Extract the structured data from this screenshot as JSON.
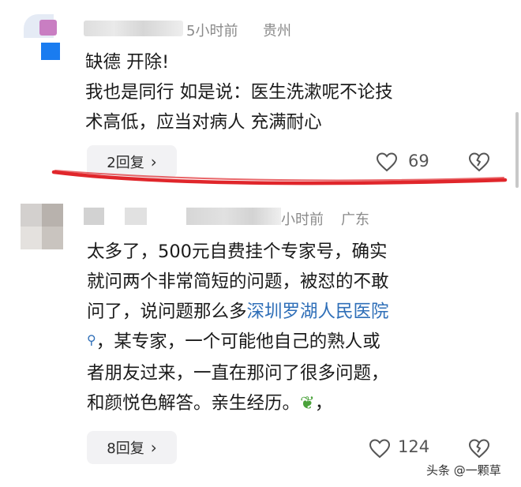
{
  "comments": [
    {
      "time": "5小时前",
      "location": "贵州",
      "lines": [
        "缺德 开除!",
        "我也是同行 如是说：医生洗漱呢不论技",
        "术高低，应当对病人 充满耐心"
      ],
      "reply_label": "2回复",
      "likes": "69"
    },
    {
      "time": "小时前",
      "location": "广东",
      "lines": [
        "太多了，500元自费挂个专家号，确实",
        "就问两个非常简短的问题，被怼的不敢",
        "问了，说问题那么多"
      ],
      "link_text": "深圳罗湖人民医院",
      "after_link_lines": [
        "，某专家，一个可能他自己的熟人或",
        "者朋友过来，一直在那问了很多问题，",
        "和颜悦色解答。亲生经历。"
      ],
      "tail_after_emoji": "，",
      "reply_label": "8回复",
      "likes": "124"
    }
  ],
  "icons": {
    "reply_chevron": "chevron-right-icon",
    "like": "heart-outline-icon",
    "dislike": "broken-heart-icon",
    "search": "search-icon",
    "emoji": "leaf-emoji-icon"
  },
  "colors": {
    "link": "#2f6fb8",
    "annotation": "#e0262b",
    "meta": "#8a8a8a"
  },
  "watermark": "头条 @一颗草"
}
